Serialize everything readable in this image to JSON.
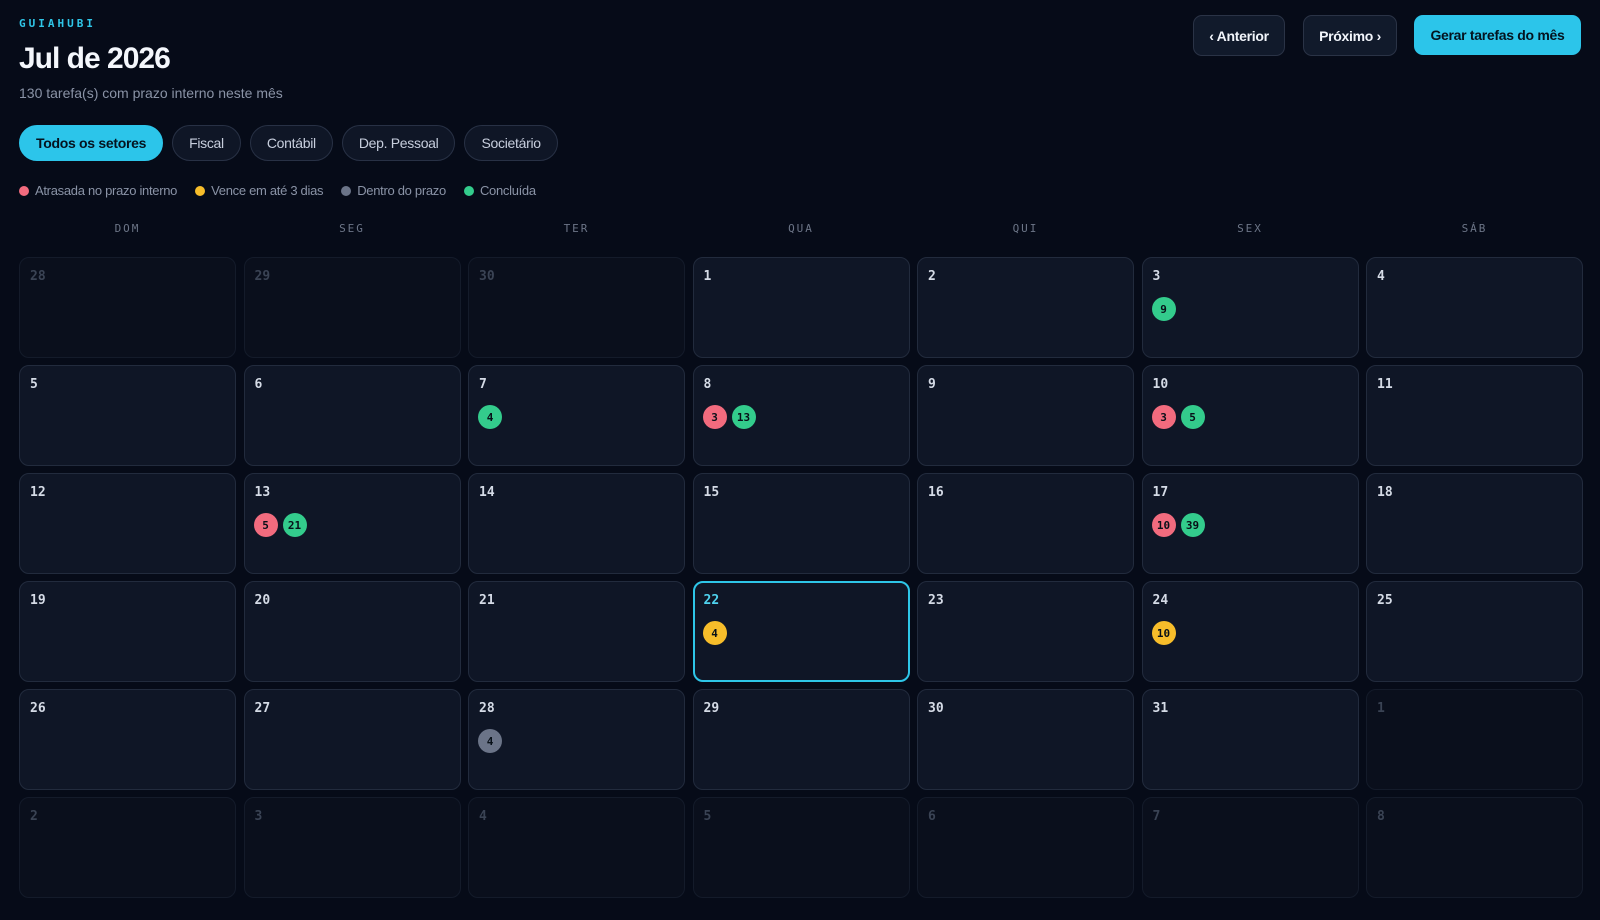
{
  "brand": "GUIAHUBI",
  "header": {
    "title": "Jul de 2026",
    "subtitle": "130 tarefa(s) com prazo interno neste mês"
  },
  "buttons": {
    "prev": "‹ Anterior",
    "next": "Próximo ›",
    "generate": "Gerar tarefas do mês"
  },
  "filters": [
    "Todos os setores",
    "Fiscal",
    "Contábil",
    "Dep. Pessoal",
    "Societário"
  ],
  "active_filter": 0,
  "legend": [
    {
      "label": "Atrasada no prazo interno",
      "color": "#f26b7e"
    },
    {
      "label": "Vence em até 3 dias",
      "color": "#f7bd2a"
    },
    {
      "label": "Dentro do prazo",
      "color": "#6b7488"
    },
    {
      "label": "Concluída",
      "color": "#33cc8c"
    }
  ],
  "status_colors": {
    "late": "#f26b7e",
    "soon": "#f7bd2a",
    "ontime": "#6b7488",
    "done": "#33cc8c"
  },
  "weekdays": [
    "DOM",
    "SEG",
    "TER",
    "QUA",
    "QUI",
    "SEX",
    "SÁB"
  ],
  "calendar": {
    "today": 22,
    "days": [
      {
        "day": "28",
        "out": true
      },
      {
        "day": "29",
        "out": true
      },
      {
        "day": "30",
        "out": true
      },
      {
        "day": "1"
      },
      {
        "day": "2"
      },
      {
        "day": "3",
        "badges": [
          {
            "status": "done",
            "count": "9"
          }
        ]
      },
      {
        "day": "4"
      },
      {
        "day": "5"
      },
      {
        "day": "6"
      },
      {
        "day": "7",
        "badges": [
          {
            "status": "done",
            "count": "4"
          }
        ]
      },
      {
        "day": "8",
        "badges": [
          {
            "status": "late",
            "count": "3"
          },
          {
            "status": "done",
            "count": "13"
          }
        ]
      },
      {
        "day": "9"
      },
      {
        "day": "10",
        "badges": [
          {
            "status": "late",
            "count": "3"
          },
          {
            "status": "done",
            "count": "5"
          }
        ]
      },
      {
        "day": "11"
      },
      {
        "day": "12"
      },
      {
        "day": "13",
        "badges": [
          {
            "status": "late",
            "count": "5"
          },
          {
            "status": "done",
            "count": "21"
          }
        ]
      },
      {
        "day": "14"
      },
      {
        "day": "15"
      },
      {
        "day": "16"
      },
      {
        "day": "17",
        "badges": [
          {
            "status": "late",
            "count": "10"
          },
          {
            "status": "done",
            "count": "39"
          }
        ]
      },
      {
        "day": "18"
      },
      {
        "day": "19"
      },
      {
        "day": "20"
      },
      {
        "day": "21"
      },
      {
        "day": "22",
        "today": true,
        "badges": [
          {
            "status": "soon",
            "count": "4"
          }
        ]
      },
      {
        "day": "23"
      },
      {
        "day": "24",
        "badges": [
          {
            "status": "soon",
            "count": "10"
          }
        ]
      },
      {
        "day": "25"
      },
      {
        "day": "26"
      },
      {
        "day": "27"
      },
      {
        "day": "28",
        "badges": [
          {
            "status": "ontime",
            "count": "4"
          }
        ]
      },
      {
        "day": "29"
      },
      {
        "day": "30"
      },
      {
        "day": "31"
      },
      {
        "day": "1",
        "out": true
      },
      {
        "day": "2",
        "out": true
      },
      {
        "day": "3",
        "out": true
      },
      {
        "day": "4",
        "out": true
      },
      {
        "day": "5",
        "out": true
      },
      {
        "day": "6",
        "out": true
      },
      {
        "day": "7",
        "out": true
      },
      {
        "day": "8",
        "out": true
      }
    ]
  }
}
